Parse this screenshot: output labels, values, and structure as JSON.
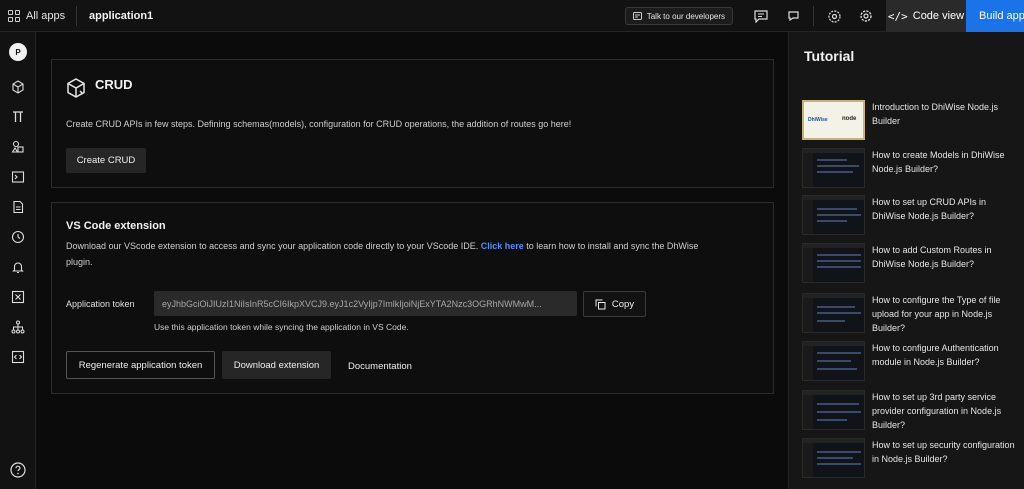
{
  "topbar": {
    "all_apps": "All apps",
    "app_name": "application1",
    "talk_button": "Talk to our developers",
    "code_view": "Code view",
    "build_app": "Build app"
  },
  "sidebar": {
    "avatar": "P",
    "icons": [
      "cube-icon",
      "pi-icon",
      "shapes-icon",
      "terminal-icon",
      "document-icon",
      "clock-icon",
      "bell-icon",
      "function-icon",
      "sitemap-icon",
      "code-window-icon"
    ]
  },
  "crud": {
    "title": "CRUD",
    "description": "Create CRUD APIs in few steps. Defining schemas(models), configuration for CRUD operations, the addition of routes go here!",
    "button": "Create CRUD"
  },
  "vscode": {
    "title": "VS Code extension",
    "desc_before": "Download our VScode extension to access and sync your application code directly to your VScode IDE. ",
    "desc_link": "Click here",
    "desc_after": " to learn how to install and sync the DhWise plugin.",
    "token_label": "Application token",
    "token_value": "eyJhbGciOiJIUzI1NiIsInR5cCI6IkpXVCJ9.eyJ1c2VyIjp7ImlkIjoiNjExYTA2Nzc3OGRhNWMwM...",
    "copy_label": "Copy",
    "token_hint": "Use this application token while syncing the application in VS Code.",
    "regenerate_label": "Regenerate application token",
    "download_label": "Download extension",
    "documentation_label": "Documentation"
  },
  "tutorial": {
    "title": "Tutorial",
    "items": [
      {
        "text": "Introduction to DhiWise Node.js Builder"
      },
      {
        "text": "How to create Models in DhiWise Node.js Builder?"
      },
      {
        "text": "How to set up CRUD APIs in DhiWise Node.js Builder?"
      },
      {
        "text": "How to add Custom Routes in DhiWise Node.js Builder?"
      },
      {
        "text": "How to configure the Type of file upload for your app in Node.js Builder?"
      },
      {
        "text": "How to configure Authentication module in Node.js Builder?"
      },
      {
        "text": "How to set up 3rd party service provider configuration in Node.js Builder?"
      },
      {
        "text": "How to set up security configuration in Node.js Builder?"
      }
    ]
  },
  "colors": {
    "accent": "#1a73e8",
    "link": "#4d8ef7",
    "background": "#0b0b0b"
  }
}
